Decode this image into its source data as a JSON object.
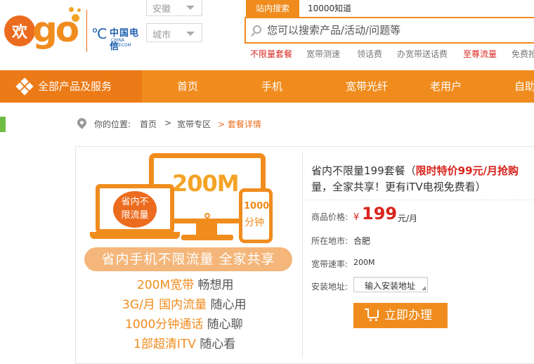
{
  "header": {
    "logo_huan": "欢",
    "logo_go": "go",
    "telecom_cn": "中国电信",
    "telecom_en": "CHINA TELECOM",
    "province": "安徽",
    "city": "城市"
  },
  "search": {
    "tabs": [
      "站内搜索",
      "10000知道"
    ],
    "placeholder": "您可以搜索产品/活动/问题等",
    "hot_links": [
      {
        "label": "不限量套餐",
        "highlight": true
      },
      {
        "label": "宽带测速",
        "highlight": false
      },
      {
        "label": "领话费",
        "highlight": false
      },
      {
        "label": "办宽带送话费",
        "highlight": false
      },
      {
        "label": "至尊流量",
        "highlight": true
      },
      {
        "label": "免费抢",
        "highlight": false
      }
    ]
  },
  "nav": {
    "all_products": "全部产品及服务",
    "items": [
      "首页",
      "手机",
      "宽带光纤",
      "老用户",
      "自助"
    ]
  },
  "breadcrumb": {
    "prefix": "你的位置:",
    "items": [
      "首页",
      ">",
      "宽带专区",
      "> 套餐详情"
    ]
  },
  "promo": {
    "monitor_text": "200M",
    "badge_line1": "省内不",
    "badge_line2": "限流量",
    "phone_line1": "1000",
    "phone_line2": "分钟",
    "banner": "省内手机不限流量 全家共享",
    "features": [
      {
        "hl": "200M宽带",
        "rest": " 畅想用"
      },
      {
        "hl": "3G/月 国内流量",
        "rest": " 随心用"
      },
      {
        "hl": "1000分钟通话",
        "rest": " 随心聊"
      },
      {
        "hl": "1部超清ITV",
        "rest": " 随心看"
      }
    ]
  },
  "product": {
    "title_start": "省内不限量199套餐（",
    "title_highlight": "限时特价99元/月抢购",
    "title_end": "量，全家共享！更有iTV电视免费看）",
    "price_label": "商品价格:",
    "currency": "¥",
    "price": "199",
    "price_unit": "元/月",
    "city_label": "所在地市:",
    "city": "合肥",
    "speed_label": "宽带速率:",
    "speed": "200M",
    "address_label": "安装地址:",
    "address_placeholder": "输入安装地址",
    "buy_label": "立即办理"
  },
  "colors": {
    "brand_orange": "#f08c1e",
    "nav_dark": "#ec7a16",
    "price_red": "#d9241c",
    "telecom_blue": "#1e5fae"
  }
}
